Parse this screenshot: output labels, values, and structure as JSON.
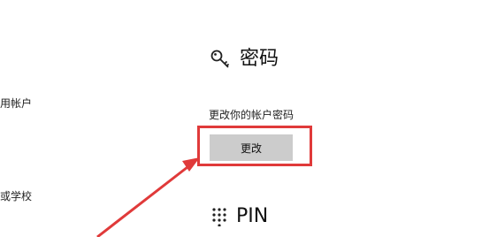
{
  "sidebar": {
    "items": [
      {
        "label": "用帐户"
      },
      {
        "label": "或学校"
      }
    ]
  },
  "password_section": {
    "title": "密码",
    "icon": "key-icon",
    "description": "更改你的帐户密码",
    "button_label": "更改"
  },
  "pin_section": {
    "title": "PIN",
    "icon": "keypad-icon"
  },
  "colors": {
    "annotation": "#e03a3a",
    "button_bg": "#cccccc"
  }
}
